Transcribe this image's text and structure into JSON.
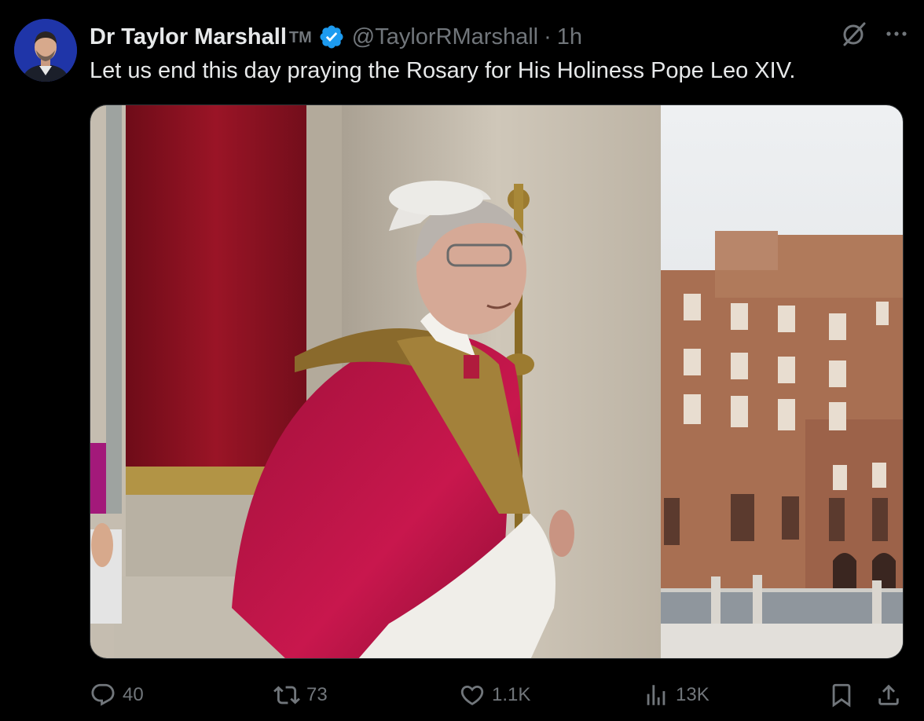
{
  "author": {
    "display_name": "Dr Taylor Marshall",
    "tm": "TM",
    "handle": "@TaylorRMarshall",
    "separator": "·",
    "time": "1h",
    "verified": true,
    "avatar_icon": "profile-photo"
  },
  "header_icons": [
    "grok-icon",
    "more-icon"
  ],
  "tweet": {
    "text": "Let us end this day praying the Rosary for His Holiness Pope Leo XIV."
  },
  "media": {
    "type": "photo"
  },
  "actions": {
    "replies": "40",
    "reposts": "73",
    "likes": "1.1K",
    "views": "13K"
  },
  "colors": {
    "background": "#000000",
    "text": "#e7e9ea",
    "muted": "#71767b",
    "verified_blue": "#1d9bf0",
    "border": "#2f3336"
  }
}
